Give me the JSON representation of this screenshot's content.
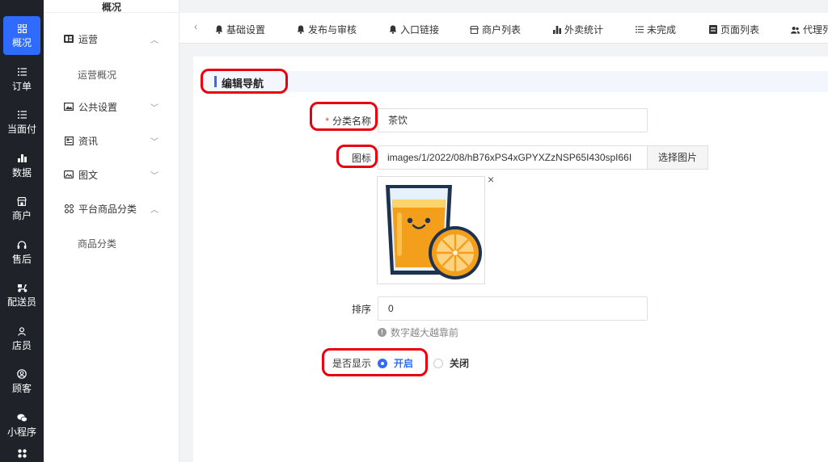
{
  "rail": {
    "items": [
      {
        "label": "概况",
        "icon": "grid-icon",
        "active": true
      },
      {
        "label": "订单",
        "icon": "list-icon"
      },
      {
        "label": "当面付",
        "icon": "list-icon"
      },
      {
        "label": "数据",
        "icon": "bar-chart-icon"
      },
      {
        "label": "商户",
        "icon": "store-icon"
      },
      {
        "label": "售后",
        "icon": "headset-icon"
      },
      {
        "label": "配送员",
        "icon": "scooter-icon"
      },
      {
        "label": "店员",
        "icon": "user-icon"
      },
      {
        "label": "顾客",
        "icon": "user-circle-icon"
      },
      {
        "label": "小程序",
        "icon": "wechat-icon"
      },
      {
        "label": "",
        "icon": "apps-icon"
      }
    ]
  },
  "sidebar": {
    "title": "概况",
    "menu": [
      {
        "label": "运营",
        "icon": "dashboard-icon",
        "chevron": "up"
      },
      {
        "label": "公共设置",
        "icon": "image-icon",
        "chevron": "down"
      },
      {
        "label": "资讯",
        "icon": "news-icon",
        "chevron": "down"
      },
      {
        "label": "图文",
        "icon": "picture-icon",
        "chevron": "down"
      },
      {
        "label": "平台商品分类",
        "icon": "category-icon",
        "chevron": "up"
      }
    ],
    "sub": [
      "运营概况",
      "商品分类"
    ]
  },
  "tabs": {
    "back": "‹",
    "items": [
      {
        "label": "基础设置",
        "icon": "bell-icon"
      },
      {
        "label": "发布与审核",
        "icon": "bell-icon"
      },
      {
        "label": "入口链接",
        "icon": "bell-icon"
      },
      {
        "label": "商户列表",
        "icon": "store-icon"
      },
      {
        "label": "外卖统计",
        "icon": "bar-chart-icon"
      },
      {
        "label": "未完成",
        "icon": "list-icon"
      },
      {
        "label": "页面列表",
        "icon": "page-icon"
      },
      {
        "label": "代理列",
        "icon": "users-icon"
      }
    ]
  },
  "form": {
    "section_title": "编辑导航",
    "name_label": "分类名称",
    "name_required": "*",
    "name_value": "茶饮",
    "icon_label": "图标",
    "icon_path": "images/1/2022/08/hB76xPS4xGPYXZzNSP65I430spI66I",
    "pick_button": "选择图片",
    "remove_icon": "×",
    "sort_label": "排序",
    "sort_value": "0",
    "sort_hint": "数字越大越靠前",
    "sort_hint_icon": "!",
    "show_label": "是否显示",
    "show_on": "开启",
    "show_off": "关闭",
    "show_selected": "开启"
  },
  "colors": {
    "accent": "#2f6bff",
    "rail_bg": "#1f2329",
    "annotation": "#e8000e"
  }
}
